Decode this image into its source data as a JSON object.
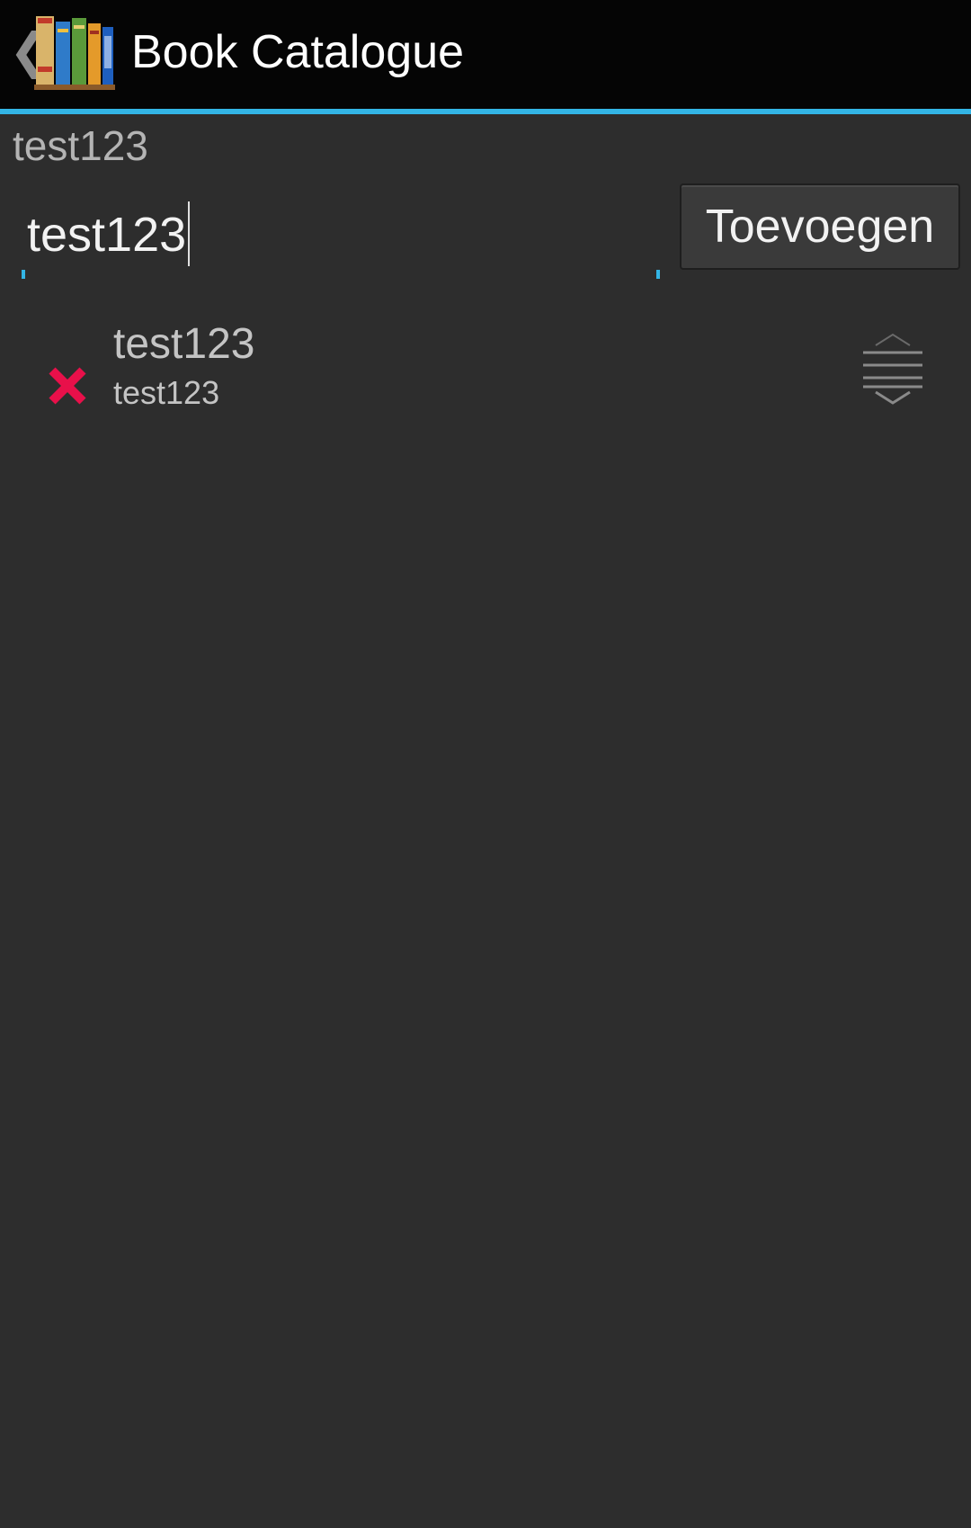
{
  "action_bar": {
    "title": "Book Catalogue",
    "up_icon": "chevron-left-icon",
    "app_icon": "bookshelf-icon",
    "accent_color": "#33b5e5",
    "background_color": "#050505"
  },
  "section": {
    "label": "test123"
  },
  "add_form": {
    "input_value": "test123",
    "add_button_label": "Toevoegen"
  },
  "list": {
    "items": [
      {
        "title": "test123",
        "subtitle": "test123",
        "delete_icon": "delete-x-icon",
        "delete_color": "#e8104a",
        "drag_icon": "drag-handle-icon"
      }
    ]
  },
  "colors": {
    "background": "#2d2d2d"
  }
}
